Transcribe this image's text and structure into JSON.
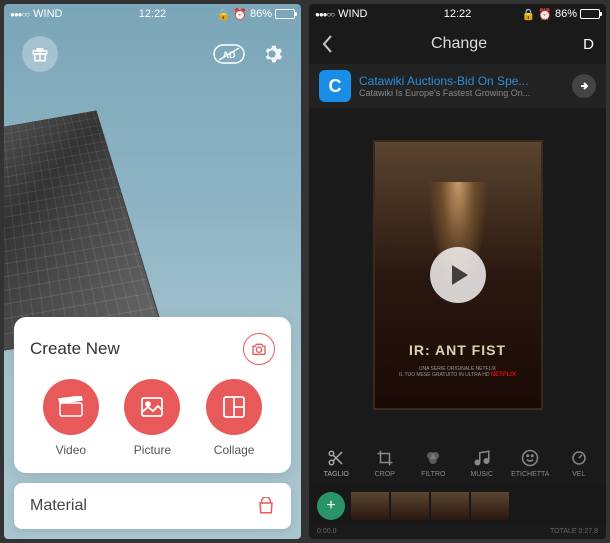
{
  "left": {
    "status": {
      "carrier": "WIND",
      "time": "12:22",
      "battery": "86%"
    },
    "create": {
      "title": "Create New",
      "options": [
        {
          "label": "Video",
          "icon": "clapperboard"
        },
        {
          "label": "Picture",
          "icon": "image"
        },
        {
          "label": "Collage",
          "icon": "grid"
        }
      ]
    },
    "material": {
      "title": "Material"
    }
  },
  "right": {
    "status": {
      "carrier": "WIND",
      "time": "12:22",
      "battery": "86%"
    },
    "header": {
      "title": "Change",
      "done": "D"
    },
    "ad": {
      "logo_letter": "C",
      "title": "Catawiki Auctions-Bid On Spe...",
      "subtitle": "Catawiki Is Europe's Fastest Growing On..."
    },
    "poster": {
      "title": "IR: ANT FIST",
      "subtitle": "UNA SERIE ORIGINALE NETFLIX",
      "tagline": "IL TUO MESE GRATUITO IN ULTRA HD",
      "brand": "NETFLIX"
    },
    "tools": [
      {
        "label": "Taglio",
        "icon": "scissors"
      },
      {
        "label": "Crop",
        "icon": "crop"
      },
      {
        "label": "Filtro",
        "icon": "filter"
      },
      {
        "label": "Music",
        "icon": "music"
      },
      {
        "label": "Etichetta",
        "icon": "emoji"
      },
      {
        "label": "Vel",
        "icon": "speed"
      }
    ],
    "timeline": {
      "start": "0:00.0",
      "total": "TOTALE 0:27.8"
    }
  }
}
